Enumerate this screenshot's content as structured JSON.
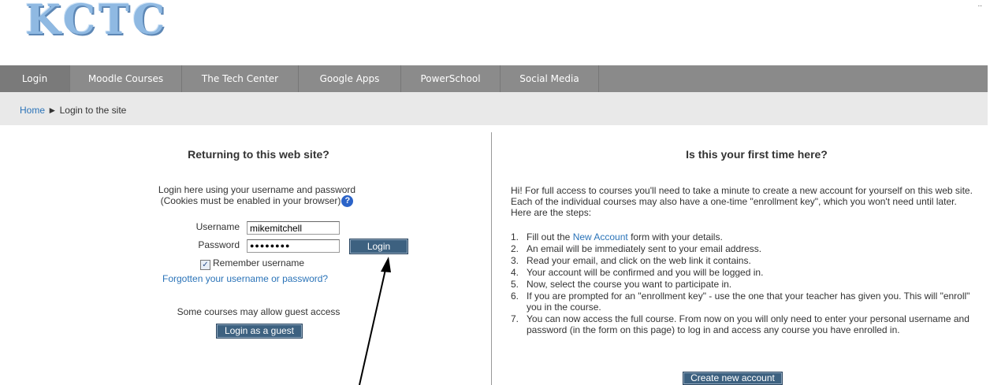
{
  "logo": {
    "text": "KCTC"
  },
  "corner_mark": "..",
  "nav": {
    "items": [
      {
        "label": "Login",
        "name": "nav-item-login"
      },
      {
        "label": "Moodle Courses",
        "name": "nav-item-moodle-courses"
      },
      {
        "label": "The Tech Center",
        "name": "nav-item-tech-center"
      },
      {
        "label": "Google Apps",
        "name": "nav-item-google-apps"
      },
      {
        "label": "PowerSchool",
        "name": "nav-item-powerschool"
      },
      {
        "label": "Social Media",
        "name": "nav-item-social-media"
      }
    ]
  },
  "breadcrumb": {
    "home": "Home",
    "separator": "►",
    "current": "Login to the site"
  },
  "login": {
    "title": "Returning to this web site?",
    "intro_line1": "Login here using your username and password",
    "intro_line2": "(Cookies must be enabled in your browser)",
    "help_icon": "?",
    "username_label": "Username",
    "username_value": "mikemitchell",
    "password_label": "Password",
    "password_value": "●●●●●●●●",
    "login_button": "Login",
    "remember_checked": true,
    "remember_label": "Remember username",
    "forgot_link": "Forgotten your username or password?",
    "guest_text": "Some courses may allow guest access",
    "guest_button": "Login as a guest"
  },
  "signup": {
    "title": "Is this your first time here?",
    "intro": "Hi! For full access to courses you'll need to take a minute to create a new account for yourself on this web site. Each of the individual courses may also have a one-time \"enrollment key\", which you won't need until later. Here are the steps:",
    "step1_prefix": "Fill out the ",
    "step1_link": "New Account",
    "step1_suffix": " form with your details.",
    "steps": [
      "An email will be immediately sent to your email address.",
      "Read your email, and click on the web link it contains.",
      "Your account will be confirmed and you will be logged in.",
      "Now, select the course you want to participate in.",
      "If you are prompted for an \"enrollment key\" - use the one that your teacher has given you. This will \"enroll\" you in the course.",
      "You can now access the full course. From now on you will only need to enter your personal username and password (in the form on this page) to log in and access any course you have enrolled in."
    ],
    "create_button": "Create new account"
  }
}
